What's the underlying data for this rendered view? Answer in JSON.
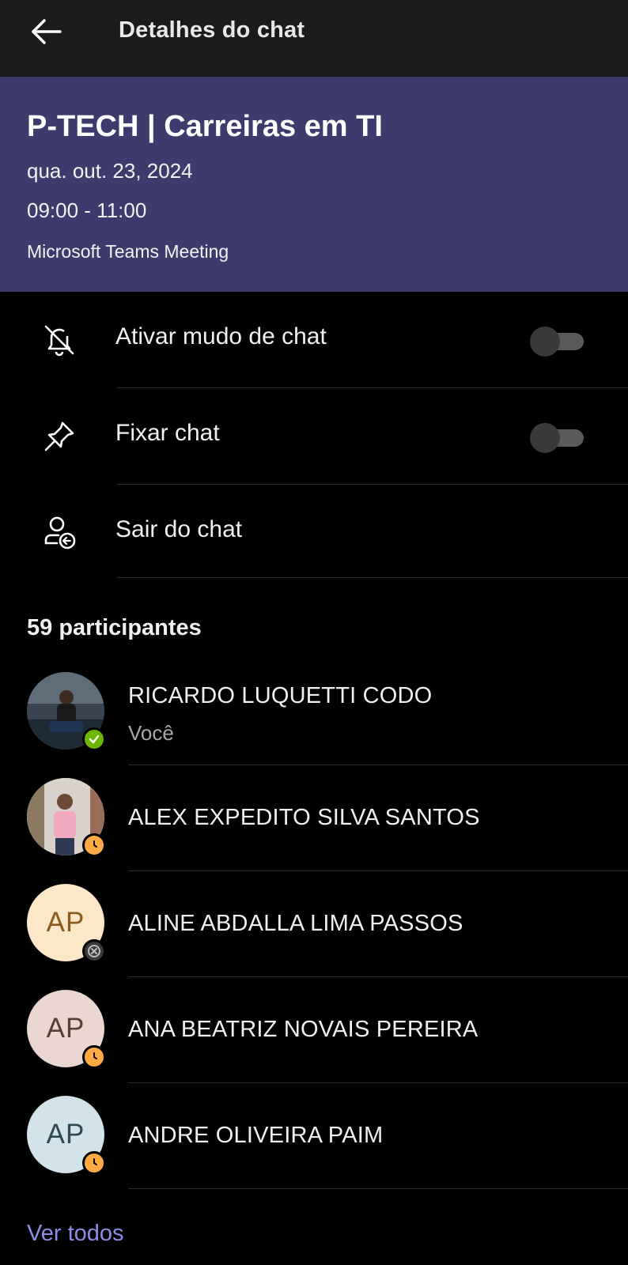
{
  "header": {
    "title": "Detalhes do chat",
    "back_icon": "arrow-left-icon"
  },
  "meeting": {
    "title": "P-TECH | Carreiras em TI",
    "date": "qua. out. 23, 2024",
    "time": "09:00 - 11:00",
    "type": "Microsoft Teams Meeting",
    "background_color": "#3c3b6c"
  },
  "options": [
    {
      "label": "Ativar mudo de chat",
      "icon": "bell-off-icon",
      "toggle": false
    },
    {
      "label": "Fixar chat",
      "icon": "pin-icon",
      "toggle": false
    },
    {
      "label": "Sair do chat",
      "icon": "person-leave-icon"
    }
  ],
  "participants": {
    "header": "59 participantes",
    "list": [
      {
        "name": "RICARDO LUQUETTI CODO",
        "subtitle": "Você",
        "avatar": "photo",
        "status": "available",
        "status_color": "#6bb700"
      },
      {
        "name": "ALEX EXPEDITO SILVA SANTOS",
        "avatar": "photo",
        "status": "away",
        "status_color": "#ffaa44"
      },
      {
        "name": "ALINE ABDALLA LIMA PASSOS",
        "initials": "AP",
        "avatar_bg": "#fde7c9",
        "avatar_fg": "#8a5a1e",
        "status": "offline",
        "status_color": "#8a8a8a"
      },
      {
        "name": "ANA BEATRIZ NOVAIS PEREIRA",
        "initials": "AP",
        "avatar_bg": "#ead7d1",
        "avatar_fg": "#5a3e36",
        "status": "away",
        "status_color": "#ffaa44"
      },
      {
        "name": "ANDRE OLIVEIRA PAIM",
        "initials": "AP",
        "avatar_bg": "#d2e3ea",
        "avatar_fg": "#2f4a57",
        "status": "away",
        "status_color": "#ffaa44"
      }
    ]
  },
  "see_all": "Ver todos",
  "colors": {
    "accent_link": "#8b8ee8",
    "topbar": "#1b1b1b"
  }
}
